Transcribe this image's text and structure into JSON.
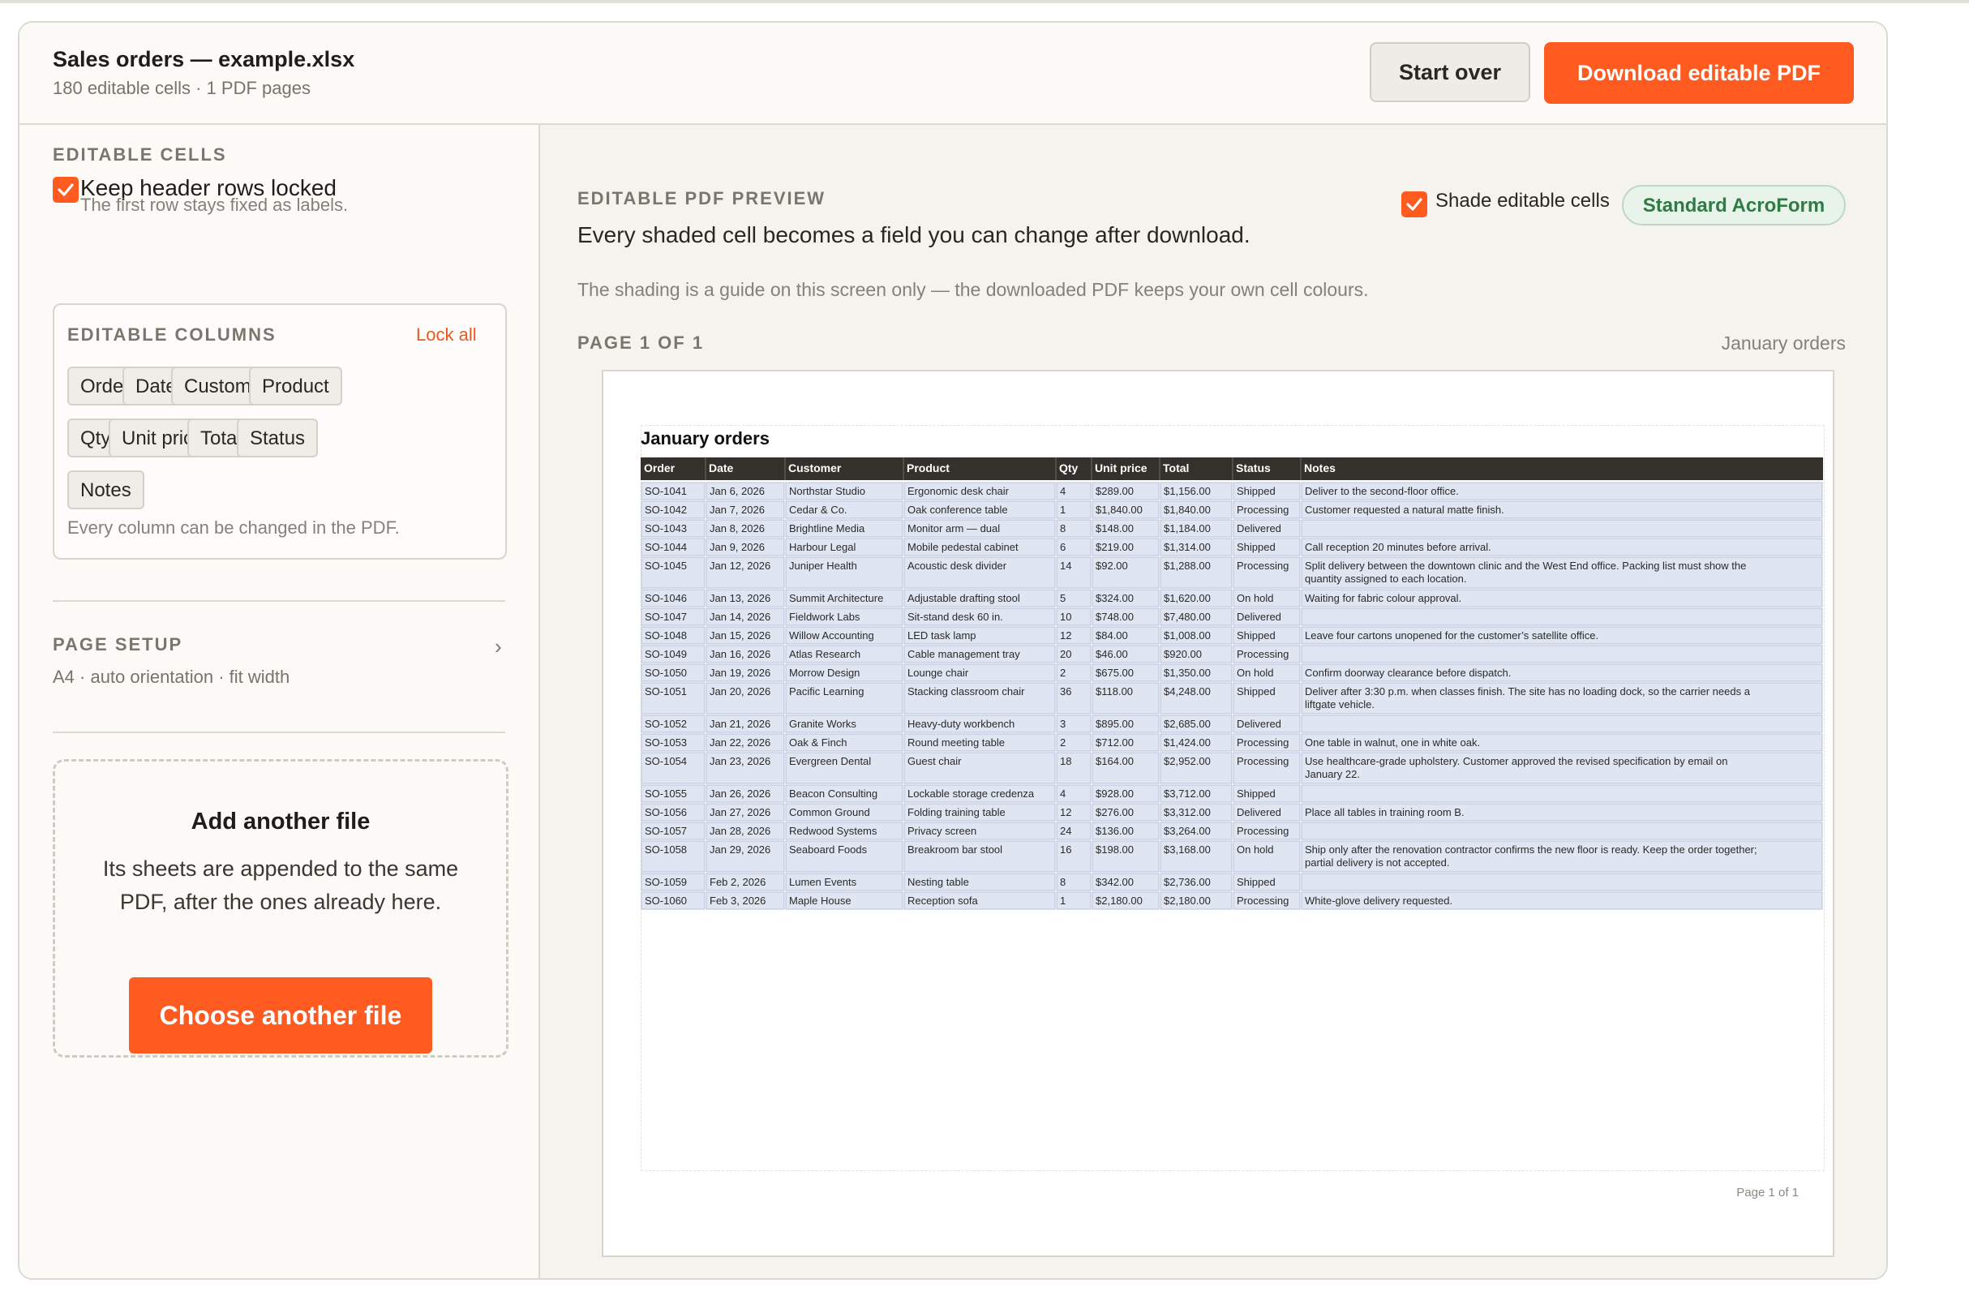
{
  "header": {
    "title": "Sales orders — example.xlsx",
    "subtitle": "180 editable cells · 1 PDF pages",
    "start_over": "Start over",
    "download": "Download editable PDF"
  },
  "sidebar": {
    "editable_cells_label": "EDITABLE CELLS",
    "keep_header_label": "Keep header rows locked",
    "keep_header_hint": "The first row stays fixed as labels.",
    "keep_header_checked": true,
    "columns_label": "EDITABLE COLUMNS",
    "lock_all": "Lock all",
    "columns": [
      "Order",
      "Date",
      "Customer",
      "Product",
      "Qty",
      "Unit price",
      "Total",
      "Status",
      "Notes"
    ],
    "columns_hint": "Every column can be changed in the PDF.",
    "page_setup_label": "PAGE SETUP",
    "page_setup_value": "A4 · auto orientation · fit width",
    "add_file_title": "Add another file",
    "add_file_text": "Its sheets are appended to the same PDF, after the ones already here.",
    "choose_file": "Choose another file"
  },
  "preview": {
    "label": "EDITABLE PDF PREVIEW",
    "lead": "Every shaded cell becomes a field you can change after download.",
    "note": "The shading is a guide on this screen only — the downloaded PDF keeps your own cell colours.",
    "shade_label": "Shade editable cells",
    "shade_checked": true,
    "format_badge": "Standard AcroForm",
    "page_label": "PAGE 1 OF 1",
    "sheet_name": "January orders",
    "page_title": "January orders",
    "page_footer": "Page 1 of 1",
    "header_bg": "#34312c",
    "cell_shade": "#dfe5f1"
  },
  "table": {
    "headers": [
      "Order",
      "Date",
      "Customer",
      "Product",
      "Qty",
      "Unit price",
      "Total",
      "Status",
      "Notes"
    ],
    "rows": [
      [
        "SO-1041",
        "Jan 6, 2026",
        "Northstar Studio",
        "Ergonomic desk chair",
        "4",
        "$289.00",
        "$1,156.00",
        "Shipped",
        "Deliver to the second-floor office."
      ],
      [
        "SO-1042",
        "Jan 7, 2026",
        "Cedar & Co.",
        "Oak conference table",
        "1",
        "$1,840.00",
        "$1,840.00",
        "Processing",
        "Customer requested a natural matte finish."
      ],
      [
        "SO-1043",
        "Jan 8, 2026",
        "Brightline Media",
        "Monitor arm — dual",
        "8",
        "$148.00",
        "$1,184.00",
        "Delivered",
        ""
      ],
      [
        "SO-1044",
        "Jan 9, 2026",
        "Harbour Legal",
        "Mobile pedestal cabinet",
        "6",
        "$219.00",
        "$1,314.00",
        "Shipped",
        "Call reception 20 minutes before arrival."
      ],
      [
        "SO-1045",
        "Jan 12, 2026",
        "Juniper Health",
        "Acoustic desk divider",
        "14",
        "$92.00",
        "$1,288.00",
        "Processing",
        "Split delivery between the downtown clinic and the West End office. Packing list must show the|quantity assigned to each location."
      ],
      [
        "SO-1046",
        "Jan 13, 2026",
        "Summit Architecture",
        "Adjustable drafting stool",
        "5",
        "$324.00",
        "$1,620.00",
        "On hold",
        "Waiting for fabric colour approval."
      ],
      [
        "SO-1047",
        "Jan 14, 2026",
        "Fieldwork Labs",
        "Sit-stand desk 60 in.",
        "10",
        "$748.00",
        "$7,480.00",
        "Delivered",
        ""
      ],
      [
        "SO-1048",
        "Jan 15, 2026",
        "Willow Accounting",
        "LED task lamp",
        "12",
        "$84.00",
        "$1,008.00",
        "Shipped",
        "Leave four cartons unopened for the customer’s satellite office."
      ],
      [
        "SO-1049",
        "Jan 16, 2026",
        "Atlas Research",
        "Cable management tray",
        "20",
        "$46.00",
        "$920.00",
        "Processing",
        ""
      ],
      [
        "SO-1050",
        "Jan 19, 2026",
        "Morrow Design",
        "Lounge chair",
        "2",
        "$675.00",
        "$1,350.00",
        "On hold",
        "Confirm doorway clearance before dispatch."
      ],
      [
        "SO-1051",
        "Jan 20, 2026",
        "Pacific Learning",
        "Stacking classroom chair",
        "36",
        "$118.00",
        "$4,248.00",
        "Shipped",
        "Deliver after 3:30 p.m. when classes finish. The site has no loading dock, so the carrier needs a|liftgate vehicle."
      ],
      [
        "SO-1052",
        "Jan 21, 2026",
        "Granite Works",
        "Heavy-duty workbench",
        "3",
        "$895.00",
        "$2,685.00",
        "Delivered",
        ""
      ],
      [
        "SO-1053",
        "Jan 22, 2026",
        "Oak & Finch",
        "Round meeting table",
        "2",
        "$712.00",
        "$1,424.00",
        "Processing",
        "One table in walnut, one in white oak."
      ],
      [
        "SO-1054",
        "Jan 23, 2026",
        "Evergreen Dental",
        "Guest chair",
        "18",
        "$164.00",
        "$2,952.00",
        "Processing",
        "Use healthcare-grade upholstery. Customer approved the revised specification by email on|January 22."
      ],
      [
        "SO-1055",
        "Jan 26, 2026",
        "Beacon Consulting",
        "Lockable storage credenza",
        "4",
        "$928.00",
        "$3,712.00",
        "Shipped",
        ""
      ],
      [
        "SO-1056",
        "Jan 27, 2026",
        "Common Ground",
        "Folding training table",
        "12",
        "$276.00",
        "$3,312.00",
        "Delivered",
        "Place all tables in training room B."
      ],
      [
        "SO-1057",
        "Jan 28, 2026",
        "Redwood Systems",
        "Privacy screen",
        "24",
        "$136.00",
        "$3,264.00",
        "Processing",
        ""
      ],
      [
        "SO-1058",
        "Jan 29, 2026",
        "Seaboard Foods",
        "Breakroom bar stool",
        "16",
        "$198.00",
        "$3,168.00",
        "On hold",
        "Ship only after the renovation contractor confirms the new floor is ready. Keep the order together;|partial delivery is not accepted."
      ],
      [
        "SO-1059",
        "Feb 2, 2026",
        "Lumen Events",
        "Nesting table",
        "8",
        "$342.00",
        "$2,736.00",
        "Shipped",
        ""
      ],
      [
        "SO-1060",
        "Feb 3, 2026",
        "Maple House",
        "Reception sofa",
        "1",
        "$2,180.00",
        "$2,180.00",
        "Processing",
        "White-glove delivery requested."
      ]
    ]
  }
}
